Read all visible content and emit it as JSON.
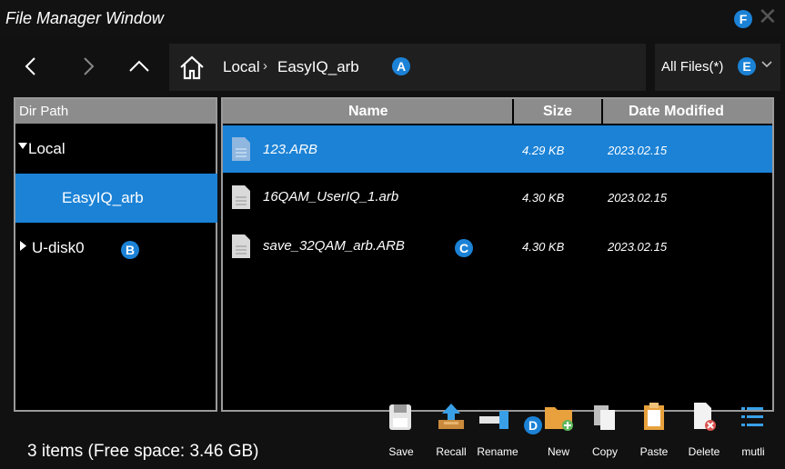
{
  "window": {
    "title": "File Manager Window"
  },
  "badges": {
    "a": "A",
    "b": "B",
    "c": "C",
    "d": "D",
    "e": "E",
    "f": "F"
  },
  "nav": {
    "back_icon": "chevron-left-icon",
    "forward_icon": "chevron-right-icon",
    "up_icon": "chevron-up-icon",
    "home_icon": "home-icon"
  },
  "breadcrumb": {
    "items": [
      "Local",
      "EasyIQ_arb"
    ],
    "separator": "›"
  },
  "filter": {
    "selected": "All Files(*)"
  },
  "dir_tree": {
    "header": "Dir Path",
    "items": [
      {
        "label": "Local",
        "expanded": true
      },
      {
        "label": "EasyIQ_arb",
        "selected": true
      },
      {
        "label": "U-disk0",
        "expanded": false
      }
    ]
  },
  "file_table": {
    "columns": [
      "Name",
      "Size",
      "Date Modified"
    ],
    "rows": [
      {
        "name": "123.ARB",
        "size": "4.29 KB",
        "date": "2023.02.15",
        "selected": true
      },
      {
        "name": "16QAM_UserIQ_1.arb",
        "size": "4.30 KB",
        "date": "2023.02.15"
      },
      {
        "name": "save_32QAM_arb.ARB",
        "size": "4.30 KB",
        "date": "2023.02.15"
      }
    ]
  },
  "status": {
    "text": "3 items (Free space: 3.46 GB)"
  },
  "toolbar": {
    "save": "Save",
    "recall": "Recall",
    "rename": "Rename",
    "new": "New",
    "copy": "Copy",
    "paste": "Paste",
    "delete": "Delete",
    "multi": "mutli"
  },
  "colors": {
    "accent": "#1b82d6",
    "header_gray": "#8c8c8c",
    "background": "#111111"
  }
}
